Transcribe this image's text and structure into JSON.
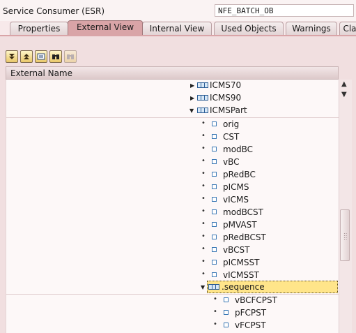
{
  "header": {
    "consumer_label": "Service Consumer (ESR)",
    "interface_name": "NFE_BATCH_OB"
  },
  "tabs": [
    {
      "label": "Properties",
      "active": false
    },
    {
      "label": "External View",
      "active": true
    },
    {
      "label": "Internal View",
      "active": false
    },
    {
      "label": "Used Objects",
      "active": false
    },
    {
      "label": "Warnings",
      "active": false
    },
    {
      "label": "Cla",
      "active": false
    }
  ],
  "toolbar": {
    "buttons": [
      "expand-all-icon",
      "collapse-all-icon",
      "details-icon",
      "find-icon",
      "find-next-icon"
    ]
  },
  "table": {
    "column_header": "External Name"
  },
  "tree": {
    "nodes": [
      {
        "label": "ICMS70",
        "state": "collapsed"
      },
      {
        "label": "ICMS90",
        "state": "collapsed"
      },
      {
        "label": "ICMSPart",
        "state": "expanded"
      }
    ],
    "icms_part_children": [
      "orig",
      "CST",
      "modBC",
      "vBC",
      "pRedBC",
      "pICMS",
      "vICMS",
      "modBCST",
      "pMVAST",
      "pRedBCST",
      "vBCST",
      "pICMSST",
      "vICMSST"
    ],
    "selected_node": {
      "label": ".sequence",
      "state": "expanded"
    },
    "sequence_children": [
      "vBCFCPST",
      "pFCPST",
      "vFCPST"
    ]
  },
  "colors": {
    "active_tab": "#d9a4a7",
    "selection": "#ffe58a",
    "panel": "#f1dfe0"
  }
}
